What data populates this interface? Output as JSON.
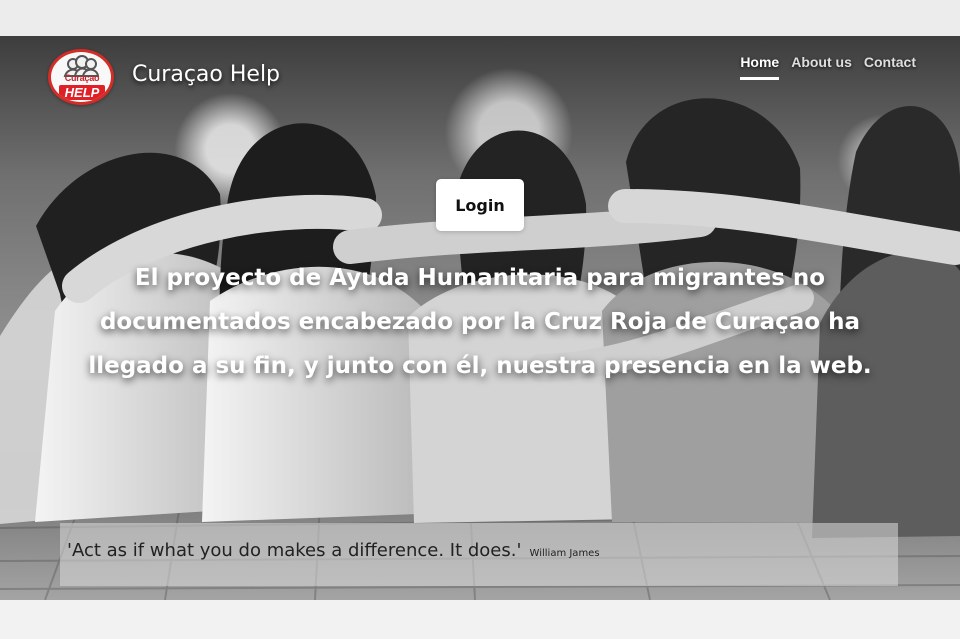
{
  "brand": {
    "logo_text": "Curaçao",
    "logo_badge": "HELP",
    "name": "Curaçao Help"
  },
  "nav": {
    "items": [
      {
        "label": "Home",
        "active": true
      },
      {
        "label": "About us",
        "active": false
      },
      {
        "label": "Contact",
        "active": false
      }
    ]
  },
  "hero": {
    "login_label": "Login",
    "headline": "El proyecto de Ayuda Humanitaria para migrantes no documentados encabezado por la Cruz Roja de Curaçao ha llegado a su fin, y junto con él, nuestra presencia en la web."
  },
  "quote": {
    "text": "'Act as if what you do makes a difference. It does.'",
    "author": "William James"
  },
  "colors": {
    "logo_red": "#d22d27",
    "nav_active": "#ffffff",
    "quote_bar": "rgba(214,214,214,0.58)"
  }
}
